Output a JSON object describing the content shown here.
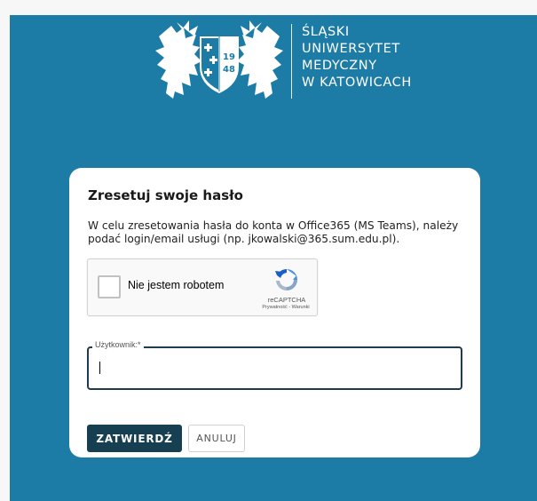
{
  "logo": {
    "crest_year_top": "19",
    "crest_year_bottom": "48",
    "lines": [
      "ŚLĄSKI",
      "UNIWERSYTET",
      "MEDYCZNY",
      "W KATOWICACH"
    ]
  },
  "card": {
    "title": "Zresetuj swoje hasło",
    "description": "W celu zresetowania hasła do konta w Office365 (MS Teams), należy podać login/email usługi (np. jkowalski@365.sum.edu.pl)."
  },
  "recaptcha": {
    "label": "Nie jestem robotem",
    "brand": "reCAPTCHA",
    "privacy": "Prywatność",
    "separator": " - ",
    "terms": "Warunki",
    "checked": false
  },
  "form": {
    "username_label": "Użytkownik:*",
    "username_value": ""
  },
  "buttons": {
    "submit": "ZATWIERDŹ",
    "cancel": "ANULUJ"
  },
  "colors": {
    "background": "#1c7ca6",
    "primary_button": "#173f52",
    "input_border": "#1f3b4d"
  }
}
